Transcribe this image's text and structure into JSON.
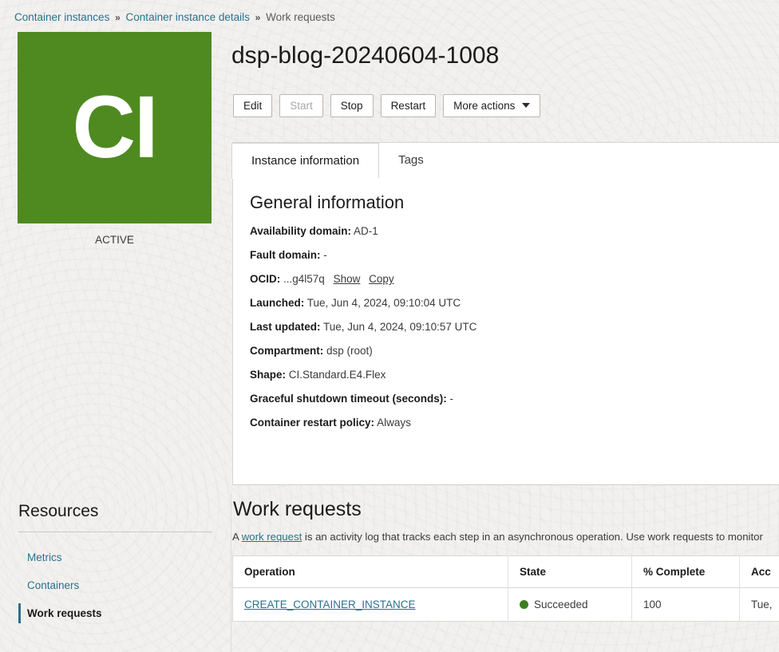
{
  "breadcrumb": {
    "items": [
      {
        "label": "Container instances",
        "link": true
      },
      {
        "label": "Container instance details",
        "link": true
      },
      {
        "label": "Work requests",
        "link": false
      }
    ],
    "separator": "»"
  },
  "instance": {
    "tile_text": "CI",
    "tile_color": "#4f8a21",
    "status": "ACTIVE",
    "title": "dsp-blog-20240604-1008"
  },
  "actions": {
    "edit": "Edit",
    "start": "Start",
    "stop": "Stop",
    "restart": "Restart",
    "more": "More actions"
  },
  "tabs": [
    {
      "label": "Instance information",
      "active": true
    },
    {
      "label": "Tags",
      "active": false
    }
  ],
  "general": {
    "heading": "General information",
    "fields": [
      {
        "label": "Availability domain:",
        "value": "AD-1"
      },
      {
        "label": "Fault domain:",
        "value": "-"
      },
      {
        "label": "OCID:",
        "value": "...g4l57q",
        "links": [
          "Show",
          "Copy"
        ]
      },
      {
        "label": "Launched:",
        "value": "Tue, Jun 4, 2024, 09:10:04 UTC"
      },
      {
        "label": "Last updated:",
        "value": "Tue, Jun 4, 2024, 09:10:57 UTC"
      },
      {
        "label": "Compartment:",
        "value": "dsp (root)"
      },
      {
        "label": "Shape:",
        "value": "CI.Standard.E4.Flex"
      },
      {
        "label": "Graceful shutdown timeout (seconds):",
        "value": "-"
      },
      {
        "label": "Container restart policy:",
        "value": "Always"
      }
    ]
  },
  "resources": {
    "heading": "Resources",
    "items": [
      {
        "label": "Metrics",
        "active": false
      },
      {
        "label": "Containers",
        "active": false
      },
      {
        "label": "Work requests",
        "active": true
      }
    ]
  },
  "work_requests": {
    "heading": "Work requests",
    "description_pre": "A ",
    "description_link": "work request",
    "description_post": " is an activity log that tracks each step in an asynchronous operation. Use work requests to monitor",
    "columns": [
      "Operation",
      "State",
      "% Complete",
      "Acc"
    ],
    "rows": [
      {
        "operation": "CREATE_CONTAINER_INSTANCE",
        "state": "Succeeded",
        "state_color": "#3e7d20",
        "percent_complete": "100",
        "accepted": "Tue,"
      }
    ]
  }
}
